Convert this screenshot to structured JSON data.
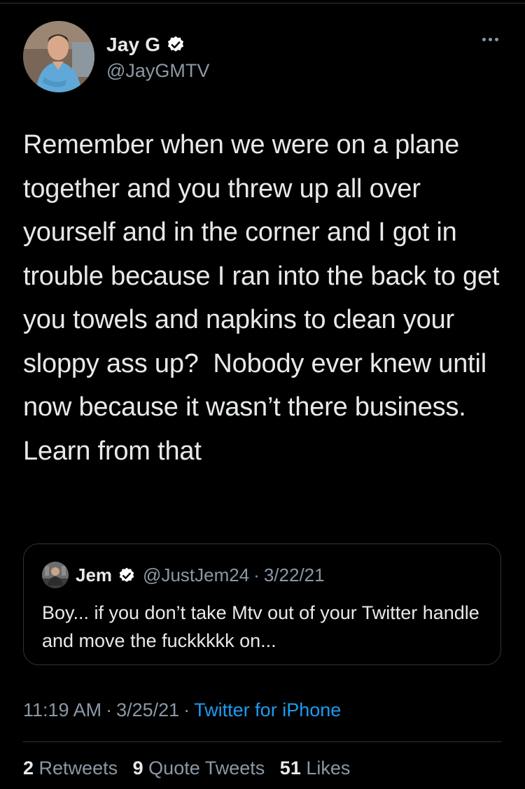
{
  "author": {
    "display_name": "Jay G",
    "handle": "@JayGMTV",
    "verified": true
  },
  "icons": {
    "verified": "verified-badge-icon",
    "more": "more-options-icon"
  },
  "tweet": {
    "text": "Remember when we were on a plane together and you threw up all over yourself and in the corner and I got in trouble because I ran into the back to get you towels and napkins to clean your sloppy ass up?  Nobody ever knew until now because it wasn’t there business. Learn from that"
  },
  "quoted_tweet": {
    "display_name": "Jem",
    "handle": "@JustJem24",
    "separator": "·",
    "date": "3/22/21",
    "text": "Boy... if you don’t take Mtv out of your Twitter handle and move the fuckkkkk on..."
  },
  "meta": {
    "time": "11:19 AM",
    "separator": "·",
    "date": "3/25/21",
    "source": "Twitter for iPhone"
  },
  "stats": {
    "retweets_count": "2",
    "retweets_label": "Retweets",
    "quotes_count": "9",
    "quotes_label": "Quote Tweets",
    "likes_count": "51",
    "likes_label": "Likes"
  },
  "colors": {
    "background": "#000000",
    "text": "#e7e9ea",
    "secondary": "#8b98a5",
    "link": "#1d9bf0",
    "verified": "#ffffff"
  }
}
